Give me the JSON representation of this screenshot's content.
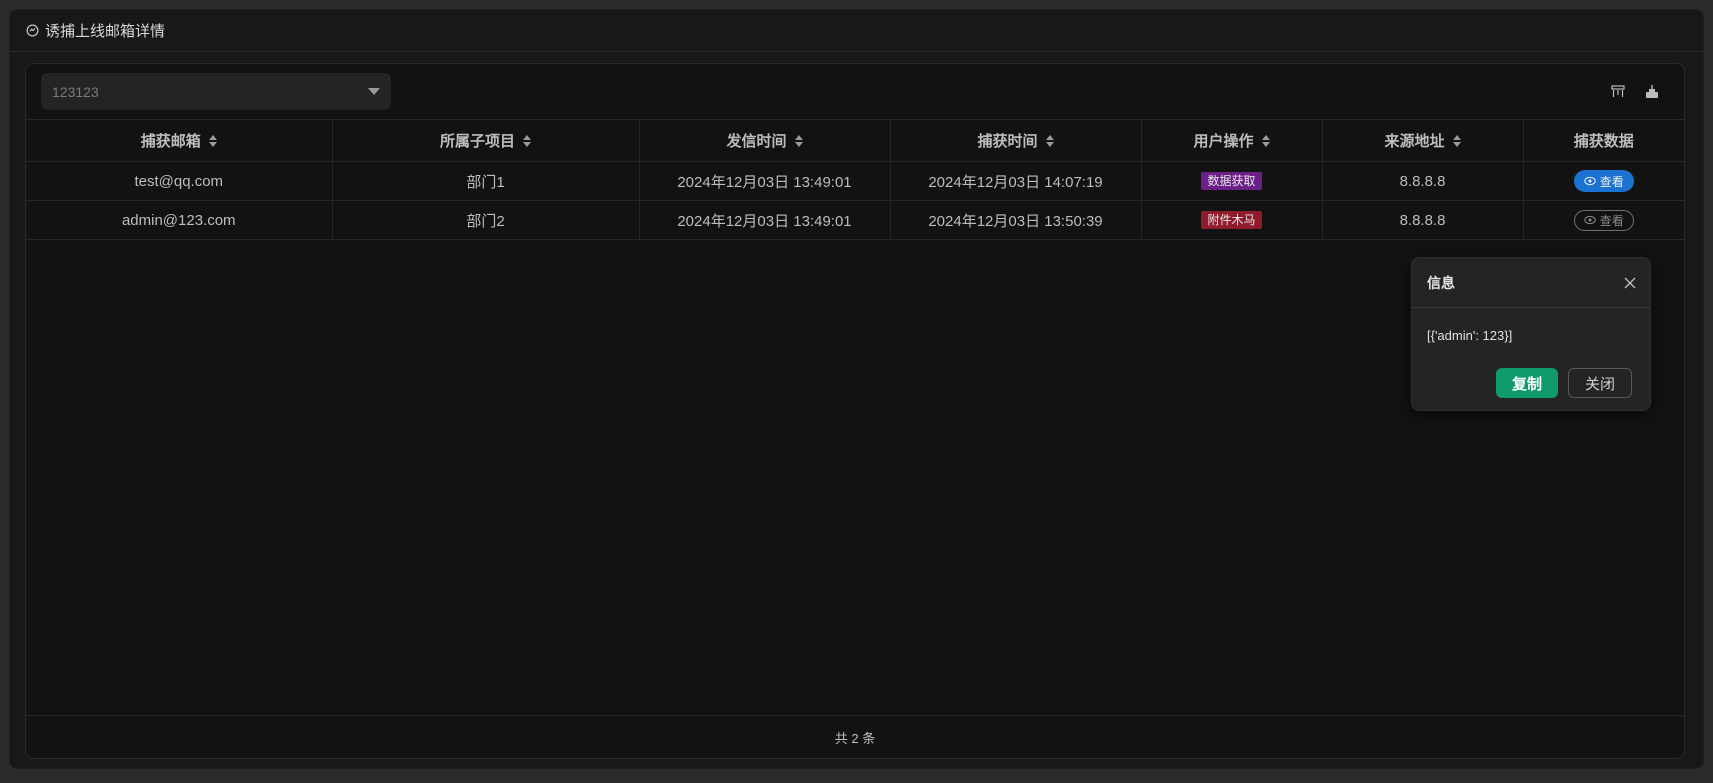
{
  "window": {
    "title": "诱捕上线邮箱详情"
  },
  "filter": {
    "selected_value": "123123"
  },
  "toolbar_icons": [
    "columns-icon",
    "export-icon"
  ],
  "table": {
    "columns": [
      "捕获邮箱",
      "所属子项目",
      "发信时间",
      "捕获时间",
      "用户操作",
      "来源地址",
      "捕获数据"
    ],
    "rows": [
      {
        "email": "test@qq.com",
        "project": "部门1",
        "sent_time": "2024年12月03日 13:49:01",
        "capture_time": "2024年12月03日 14:07:19",
        "action": "数据获取",
        "action_color": "#6b1f87",
        "source": "8.8.8.8",
        "view_label": "查看"
      },
      {
        "email": "admin@123.com",
        "project": "部门2",
        "sent_time": "2024年12月03日 13:49:01",
        "capture_time": "2024年12月03日 13:50:39",
        "action": "附件木马",
        "action_color": "#8f1c2c",
        "source": "8.8.8.8",
        "view_label": "查看"
      }
    ]
  },
  "footer": {
    "total_text": "共 2 条"
  },
  "popover": {
    "title": "信息",
    "content": "[{'admin': 123}]",
    "copy_label": "复制",
    "close_label": "关闭"
  },
  "colors": {
    "primary": "#1b72d0",
    "success": "#0f9a6a",
    "background": "#121212"
  }
}
